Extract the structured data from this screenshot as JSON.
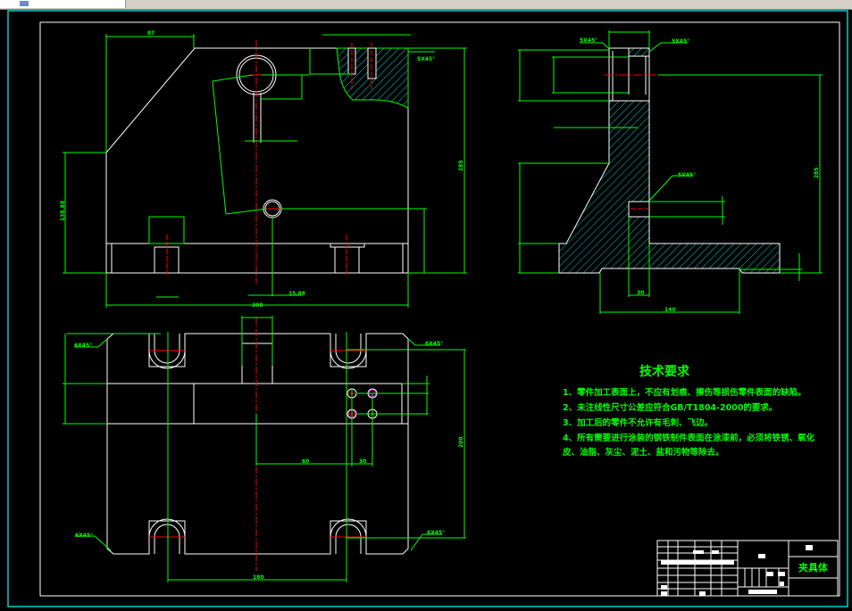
{
  "window": {
    "toolbar_tab": ""
  },
  "colors": {
    "background": "#000000",
    "outline": "#ffffff",
    "dimension": "#00ff00",
    "hatch": "#00ffff",
    "centerline": "#ff0000",
    "border": "#00ffff"
  },
  "front_view": {
    "dims": {
      "top_width": "87",
      "bottom_width": "300",
      "small_offset": "15.88",
      "left_height": "138.88",
      "right_height": "285",
      "chamfer_top": "5X45°"
    }
  },
  "side_view": {
    "dims": {
      "chamfer_left": "5X45°",
      "chamfer_right": "5X45°",
      "chamfer_mid": "5X45°",
      "bottom_width": "140",
      "stem_width": "30",
      "right_height": "285"
    }
  },
  "plan_view": {
    "dims": {
      "chamfer_tl": "6X45°",
      "chamfer_tr": "6X45°",
      "chamfer_bl": "6X45°",
      "chamfer_br": "6X45°",
      "slot_span": "180",
      "hole_offset": "60",
      "hole_pitch": "30",
      "right_height": "200"
    }
  },
  "tech_requirements": {
    "title": "技术要求",
    "items": [
      "1、零件加工表面上，不应有划痕、擦伤等损伤零件表面的缺陷。",
      "2、未注线性尺寸公差应符合GB/T1804-2000的要求。",
      "3、加工后的零件不允许有毛刺、飞边。",
      "4、所有需要进行涂装的钢铁制件表面在涂漆前，必须将铁锈、氧化",
      "皮、油脂、灰尘、泥土、盐和污物等除去。"
    ]
  },
  "title_block": {
    "part_name": "夹具体"
  }
}
